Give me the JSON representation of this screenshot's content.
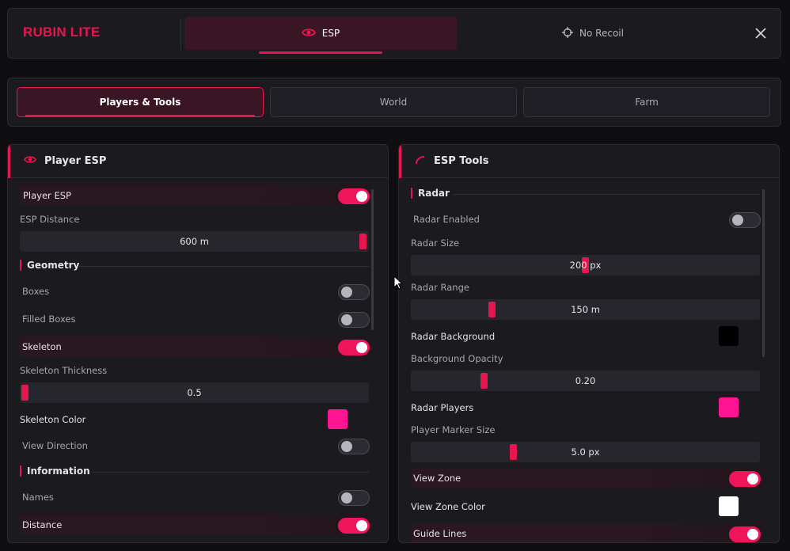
{
  "app": {
    "title": "RUBIN LITE",
    "accent": "#e8164f"
  },
  "top_tabs": [
    {
      "label": "ESP",
      "icon": "eye-icon",
      "active": true
    },
    {
      "label": "No Recoil",
      "icon": "crosshair-icon",
      "active": false
    }
  ],
  "close_icon": "close-icon",
  "sub_tabs": [
    {
      "label": "Players & Tools",
      "active": true
    },
    {
      "label": "World",
      "active": false
    },
    {
      "label": "Farm",
      "active": false
    }
  ],
  "left_panel": {
    "title": "Player ESP",
    "icon": "eye-icon",
    "player_esp": {
      "label": "Player ESP",
      "on": true
    },
    "esp_distance": {
      "label": "ESP Distance",
      "value": "600 m",
      "fraction": 1.0
    },
    "geometry": {
      "title": "Geometry",
      "boxes": {
        "label": "Boxes",
        "on": false
      },
      "filled_boxes": {
        "label": "Filled Boxes",
        "on": false
      },
      "skeleton": {
        "label": "Skeleton",
        "on": true
      },
      "skeleton_thickness": {
        "label": "Skeleton Thickness",
        "value": "0.5",
        "fraction": 0.0
      },
      "skeleton_color": {
        "label": "Skeleton Color",
        "color": "#ff1493"
      },
      "view_direction": {
        "label": "View Direction",
        "on": false
      }
    },
    "information": {
      "title": "Information",
      "names": {
        "label": "Names",
        "on": false
      },
      "distance": {
        "label": "Distance",
        "on": true
      }
    }
  },
  "right_panel": {
    "title": "ESP Tools",
    "icon": "radar-icon",
    "radar": {
      "title": "Radar",
      "radar_enabled": {
        "label": "Radar Enabled",
        "on": false
      },
      "radar_size": {
        "label": "Radar Size",
        "value": "200 px",
        "fraction": 0.5
      },
      "radar_range": {
        "label": "Radar Range",
        "value": "150 m",
        "fraction": 0.22
      },
      "radar_background": {
        "label": "Radar Background",
        "color": "#000000"
      },
      "background_opacity": {
        "label": "Background Opacity",
        "value": "0.20",
        "fraction": 0.2
      },
      "radar_players": {
        "label": "Radar Players",
        "color": "#ff1493"
      },
      "player_marker_size": {
        "label": "Player Marker Size",
        "value": "5.0 px",
        "fraction": 0.29
      },
      "view_zone": {
        "label": "View Zone",
        "on": true
      },
      "view_zone_color": {
        "label": "View Zone Color",
        "color": "#ffffff"
      },
      "guide_lines": {
        "label": "Guide Lines",
        "on": true
      }
    }
  }
}
